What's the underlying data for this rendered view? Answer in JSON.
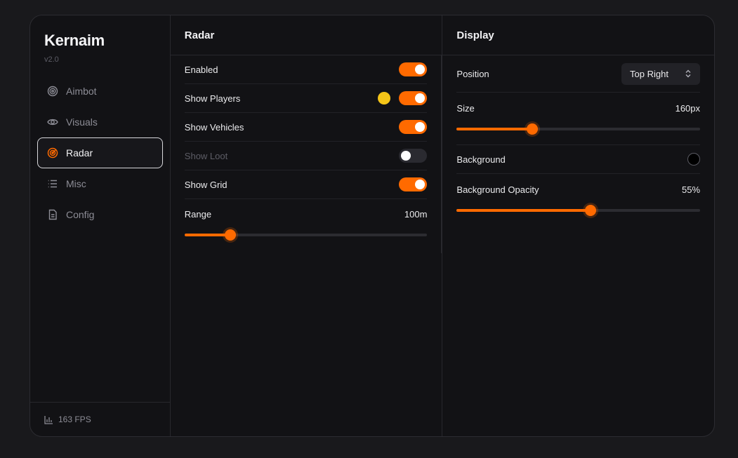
{
  "brand": {
    "title": "Kernaim",
    "version": "v2.0"
  },
  "nav": [
    {
      "label": "Aimbot",
      "icon": "target-icon",
      "active": false
    },
    {
      "label": "Visuals",
      "icon": "eye-icon",
      "active": false
    },
    {
      "label": "Radar",
      "icon": "radar-icon",
      "active": true
    },
    {
      "label": "Misc",
      "icon": "list-icon",
      "active": false
    },
    {
      "label": "Config",
      "icon": "file-icon",
      "active": false
    }
  ],
  "footer": {
    "fps": "163 FPS",
    "icon": "bar-chart-icon"
  },
  "radar": {
    "title": "Radar",
    "rows": {
      "enabled": {
        "label": "Enabled",
        "on": true
      },
      "show_players": {
        "label": "Show Players",
        "on": true,
        "color": "#f5c518"
      },
      "show_vehicles": {
        "label": "Show Vehicles",
        "on": true
      },
      "show_loot": {
        "label": "Show Loot",
        "on": false,
        "disabled": true
      },
      "show_grid": {
        "label": "Show Grid",
        "on": true
      }
    },
    "range": {
      "label": "Range",
      "value_text": "100m",
      "fraction": 0.19
    }
  },
  "display": {
    "title": "Display",
    "position": {
      "label": "Position",
      "value": "Top Right"
    },
    "size": {
      "label": "Size",
      "value_text": "160px",
      "fraction": 0.31
    },
    "background": {
      "label": "Background",
      "color": "#000000"
    },
    "opacity": {
      "label": "Background Opacity",
      "value_text": "55%",
      "fraction": 0.55
    }
  },
  "colors": {
    "accent": "#ff6a00",
    "bg": "#121215",
    "page": "#19191c"
  }
}
